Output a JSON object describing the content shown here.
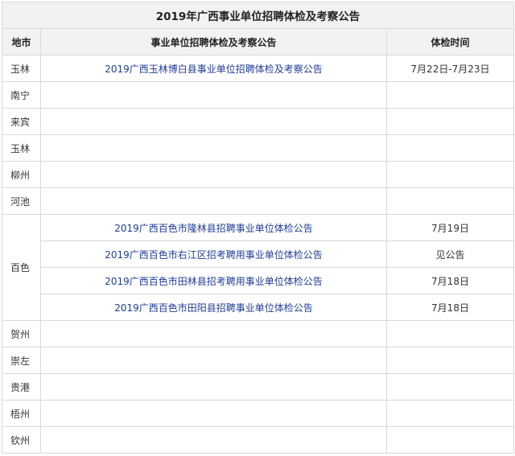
{
  "title": "2019年广西事业单位招聘体检及考察公告",
  "headers": {
    "city": "地市",
    "notice": "事业单位招聘体检及考察公告",
    "date": "体检时间"
  },
  "rows": [
    {
      "city": "玉林",
      "notice": "2019广西玉林博白县事业单位招聘体检及考察公告",
      "date": "7月22日-7月23日"
    },
    {
      "city": "南宁",
      "notice": "",
      "date": ""
    },
    {
      "city": "来宾",
      "notice": "",
      "date": ""
    },
    {
      "city": "玉林",
      "notice": "",
      "date": ""
    },
    {
      "city": "柳州",
      "notice": "",
      "date": ""
    },
    {
      "city": "河池",
      "notice": "",
      "date": ""
    },
    {
      "city": "百色",
      "notices": [
        {
          "notice": "2019广西百色市隆林县招聘事业单位体检公告",
          "date": "7月19日"
        },
        {
          "notice": "2019广西百色市右江区招考聘用事业单位体检公告",
          "date": "见公告"
        },
        {
          "notice": "2019广西百色市田林县招考聘用事业单位体检公告",
          "date": "7月18日"
        },
        {
          "notice": "2019广西百色市田阳县招聘事业单位体检公告",
          "date": "7月18日"
        }
      ]
    },
    {
      "city": "贺州",
      "notice": "",
      "date": ""
    },
    {
      "city": "崇左",
      "notice": "",
      "date": ""
    },
    {
      "city": "贵港",
      "notice": "",
      "date": ""
    },
    {
      "city": "梧州",
      "notice": "",
      "date": ""
    },
    {
      "city": "钦州",
      "notice": "",
      "date": ""
    }
  ]
}
